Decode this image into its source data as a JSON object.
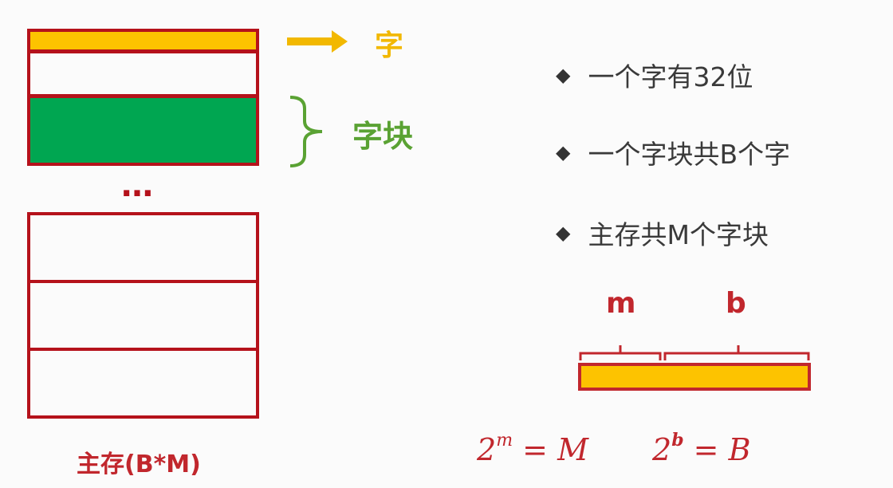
{
  "diagram": {
    "word_label": "字",
    "block_label": "字块",
    "ellipsis": "…",
    "memory_caption": "主存(B*M)",
    "bullets": [
      "一个字有32位",
      "一个字块共B个字",
      "主存共M个字块"
    ],
    "address_fields": {
      "m": "m",
      "b": "b"
    },
    "formula_1": {
      "base": "2",
      "exp": "m",
      "rhs": "= M"
    },
    "formula_2": {
      "base": "2",
      "exp": "b",
      "rhs": "= B"
    },
    "colors": {
      "border": "#b5121b",
      "word_fill": "#fdc300",
      "block_fill": "#00a651",
      "arrow": "#f2b800",
      "brace": "#5aa233",
      "formula": "#c1272d"
    }
  }
}
